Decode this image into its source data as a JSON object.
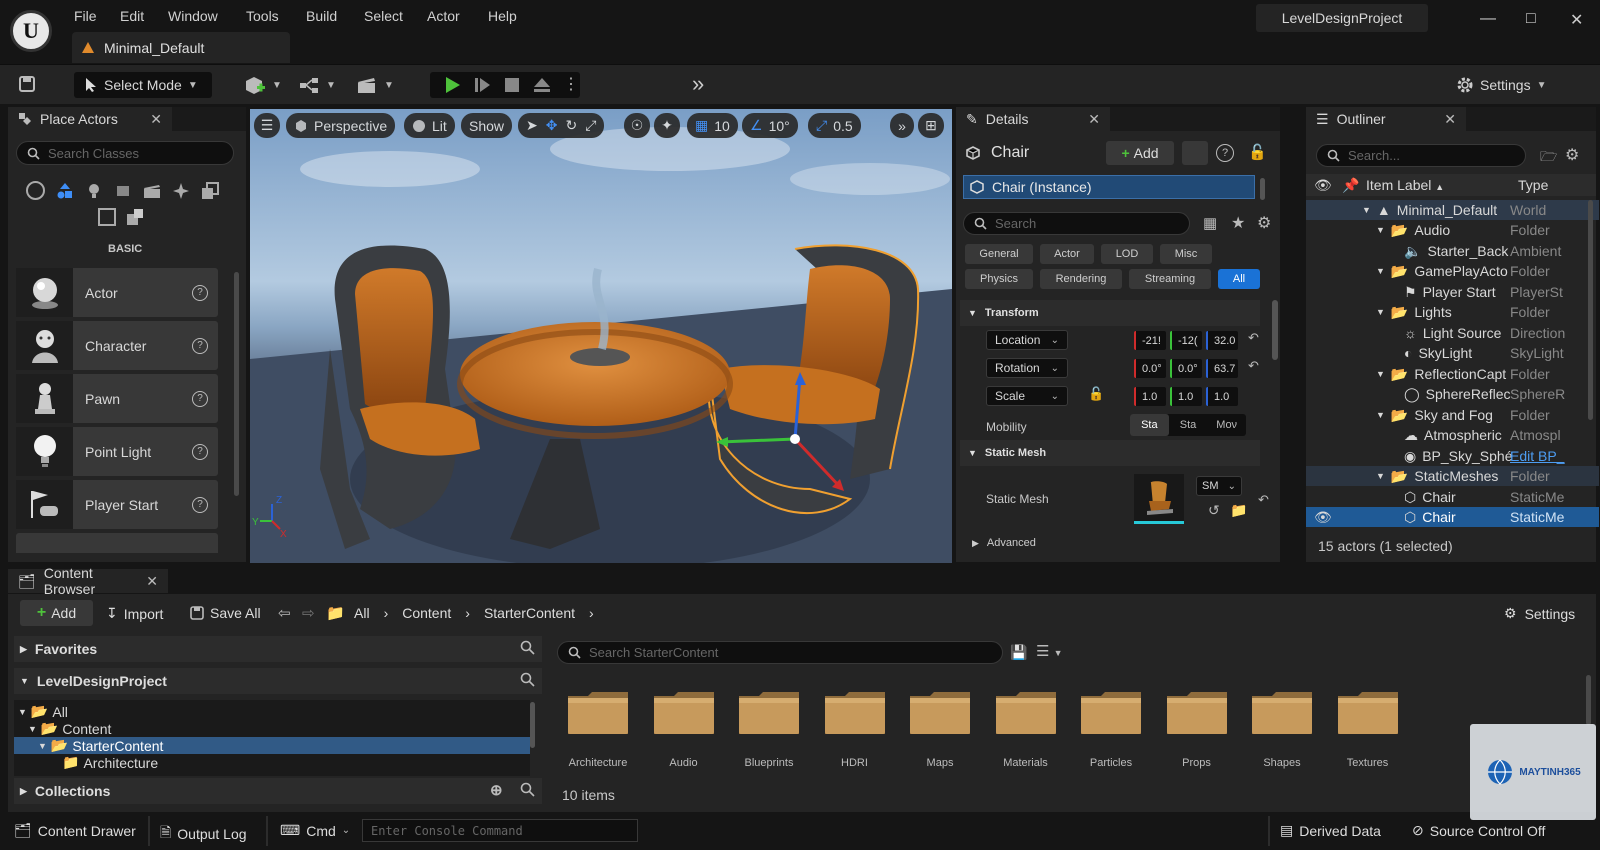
{
  "app": {
    "project_name": "LevelDesignProject",
    "level_tab": "Minimal_Default",
    "logo_letter": "U",
    "menu": [
      "File",
      "Edit",
      "Window",
      "Tools",
      "Build",
      "Select",
      "Actor",
      "Help"
    ]
  },
  "toolbar": {
    "select_mode": "Select Mode",
    "settings": "Settings"
  },
  "place_actors": {
    "title": "Place Actors",
    "search_placeholder": "Search Classes",
    "category": "BASIC",
    "items": [
      "Actor",
      "Character",
      "Pawn",
      "Point Light",
      "Player Start"
    ]
  },
  "viewport": {
    "perspective": "Perspective",
    "lit": "Lit",
    "show": "Show",
    "grid_size": "10",
    "rotation_snap": "10°",
    "scale_snap": "0.5"
  },
  "details": {
    "title": "Details",
    "object_name": "Chair",
    "add_label": "Add",
    "instance": "Chair (Instance)",
    "search_placeholder": "Search",
    "filters_row1": [
      "General",
      "Actor",
      "LOD",
      "Misc"
    ],
    "filters_row2": [
      "Physics",
      "Rendering",
      "Streaming",
      "All"
    ],
    "active_filter": "All",
    "transform_header": "Transform",
    "location_label": "Location",
    "location": [
      "-21!",
      "-12(",
      "32.0"
    ],
    "rotation_label": "Rotation",
    "rotation": [
      "0.0°",
      "0.0°",
      "63.7"
    ],
    "scale_label": "Scale",
    "scale": [
      "1.0",
      "1.0",
      "1.0"
    ],
    "mobility_label": "Mobility",
    "mobility": [
      "Sta",
      "Sta",
      "Moν"
    ],
    "static_mesh_header": "Static Mesh",
    "static_mesh_label": "Static Mesh",
    "mesh_dropdown": "SM",
    "advanced": "Advanced"
  },
  "outliner": {
    "title": "Outliner",
    "search_placeholder": "Search...",
    "col_label": "Item Label",
    "col_type": "Type",
    "rows": [
      {
        "label": "Minimal_Default",
        "type": "World"
      },
      {
        "label": "Audio",
        "type": "Folder"
      },
      {
        "label": "Starter_Back",
        "type": "Ambient"
      },
      {
        "label": "GamePlayActo",
        "type": "Folder"
      },
      {
        "label": "Player Start",
        "type": "PlayerSt"
      },
      {
        "label": "Lights",
        "type": "Folder"
      },
      {
        "label": "Light Source",
        "type": "Direction"
      },
      {
        "label": "SkyLight",
        "type": "SkyLight"
      },
      {
        "label": "ReflectionCapt",
        "type": "Folder"
      },
      {
        "label": "SphereReflec",
        "type": "SphereR"
      },
      {
        "label": "Sky and Fog",
        "type": "Folder"
      },
      {
        "label": "Atmospheric",
        "type": "Atmospl"
      },
      {
        "label": "BP_Sky_Sphé",
        "type": "Edit BP_"
      },
      {
        "label": "StaticMeshes",
        "type": "Folder"
      },
      {
        "label": "Chair",
        "type": "StaticMe"
      },
      {
        "label": "Chair",
        "type": "StaticMe"
      }
    ],
    "status": "15 actors (1 selected)"
  },
  "content_browser": {
    "title": "Content Browser",
    "add": "Add",
    "import": "Import",
    "save_all": "Save All",
    "path": [
      "All",
      "Content",
      "StarterContent"
    ],
    "settings": "Settings",
    "favorites": "Favorites",
    "project": "LevelDesignProject",
    "tree": [
      "All",
      "Content",
      "StarterContent",
      "Architecture"
    ],
    "collections": "Collections",
    "search_placeholder": "Search StarterContent",
    "folders": [
      "Architecture",
      "Audio",
      "Blueprints",
      "HDRI",
      "Maps",
      "Materials",
      "Particles",
      "Props",
      "Shapes",
      "Textures"
    ],
    "item_count": "10 items"
  },
  "statusbar": {
    "content_drawer": "Content Drawer",
    "output_log": "Output Log",
    "cmd": "Cmd",
    "console_placeholder": "Enter Console Command",
    "derived_data": "Derived Data",
    "source_control": "Source Control Off"
  },
  "watermark": {
    "text": "MAYTINH365"
  }
}
